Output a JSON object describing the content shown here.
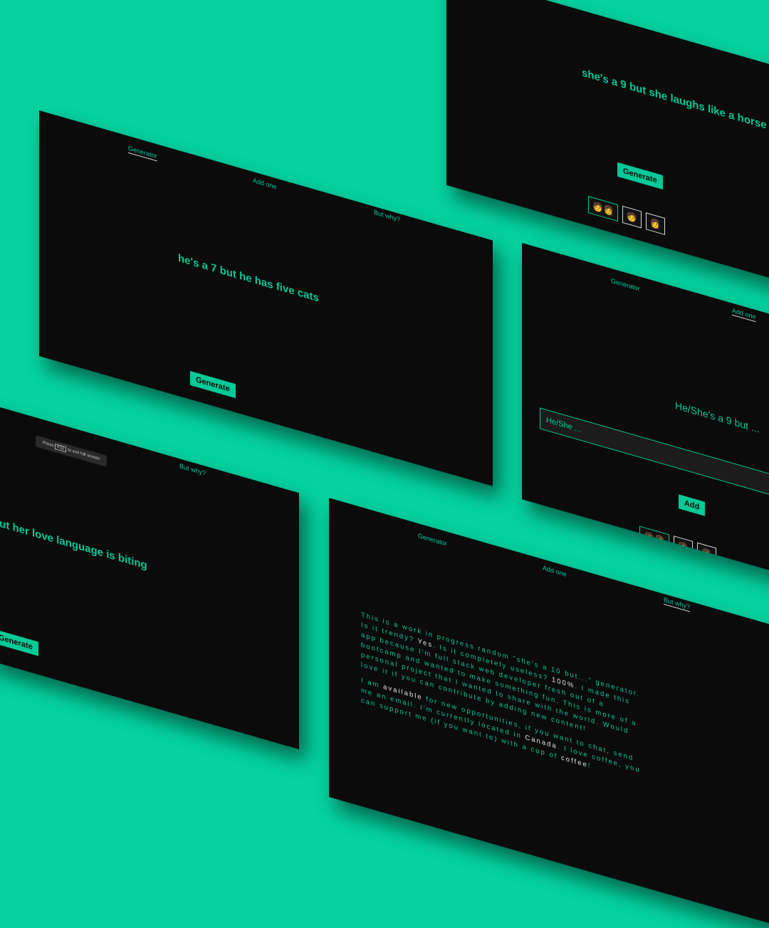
{
  "nav": {
    "generator": "Generator",
    "add_one": "Add one",
    "but_why": "But why?"
  },
  "panel_tl": {
    "quote": "he's a 7 but he has five cats",
    "button": "Generate"
  },
  "panel_tr": {
    "nav_partial": "Add one",
    "quote": "she's a 9 but she laughs like a horse",
    "button": "Generate"
  },
  "panel_mr": {
    "label": "He/She's a 9 but ...",
    "placeholder": "He/She ...",
    "button": "Add"
  },
  "panel_bl": {
    "toast_press": "Press",
    "toast_key": "F11",
    "toast_rest": "to exit full screen",
    "quote": "out her love language is biting",
    "button": "Generate"
  },
  "emoji": {
    "both": "🧑👩",
    "man": "🧑",
    "woman": "👩"
  },
  "about": {
    "p1a": "This is a work in progress random \"she's a 10 but...\" generator. Is it trendy? ",
    "p1_yes": "Yes",
    "p1b": ". Is it completely useless? ",
    "p1_pct": "100%",
    "p1c": ". I made this app because I'm full stack web developer fresh out of a bootcamp and wanted to make something fun. This is more of a personal project that I wanted to share with the world. Would love it if you can contribute by adding new content!",
    "p2a": "I am ",
    "p2_avail": "available",
    "p2b": " for new opportunities, if you want to chat, send me an email. I'm currently located in ",
    "p2_canada": "Canada",
    "p2c": ". I love coffee, you can support me (if you want to) with a cup of ",
    "p2_coffee": "coffee",
    "p2d": "!"
  },
  "colors": {
    "background": "#05d29f",
    "panel": "#0b0b0b",
    "accent": "#05c997",
    "highlight": "#e6e6e6"
  }
}
